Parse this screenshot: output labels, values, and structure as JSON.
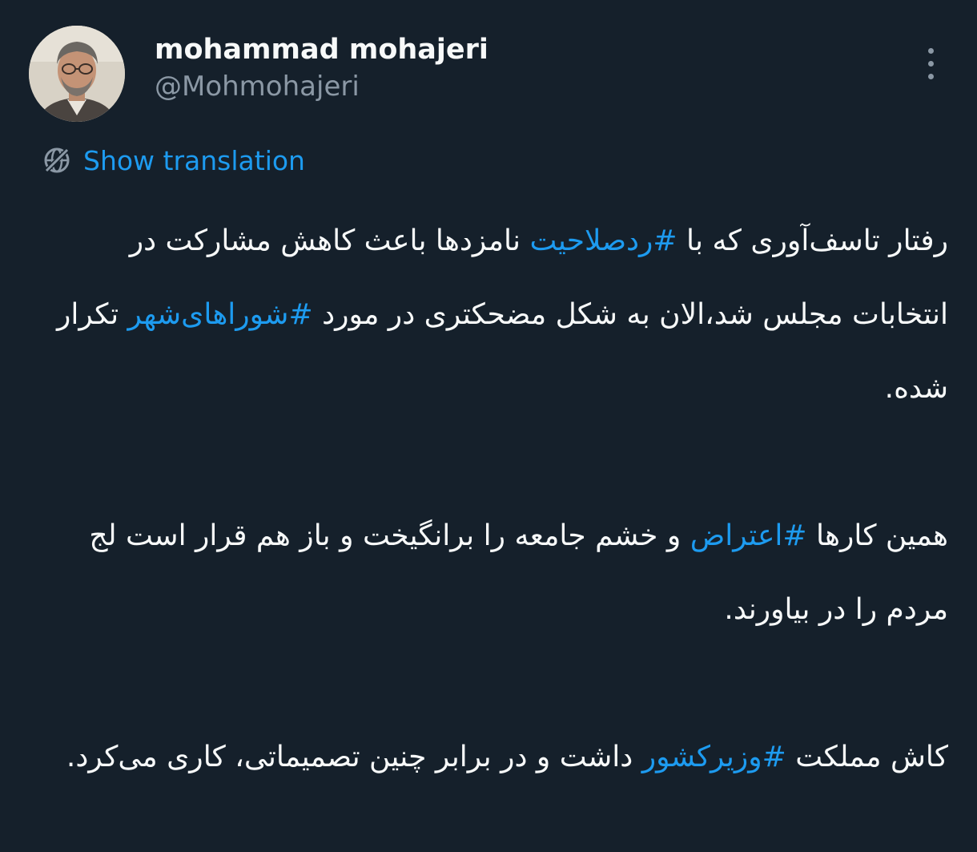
{
  "user": {
    "display_name": "mohammad mohajeri",
    "handle": "@Mohmohajeri",
    "avatar_icon": "user-avatar"
  },
  "actions": {
    "more_icon": "more-vertical-icon"
  },
  "translation": {
    "label": "Show translation",
    "icon": "translate-globe-icon"
  },
  "tweet": {
    "p1": {
      "a": "رفتار تاسف‌آوری که با ",
      "tag1": "#ردصلاحیت",
      "b": " نامزدها باعث کاهش مشارکت در انتخابات مجلس شد،الان به شکل مضحکتری در مورد ",
      "tag2": "#شوراهای‌شهر",
      "c": " تکرار شده."
    },
    "p2": {
      "a": "همین کارها ",
      "tag1": "#اعتراض",
      "b": " و خشم جامعه را برانگیخت و باز هم قرار است لج مردم را در بیاورند."
    },
    "p3": {
      "a": "کاش مملکت ",
      "tag1": "#وزیرکشور",
      "b": " داشت و در برابر چنین تصمیماتی، کاری می‌کرد."
    }
  },
  "colors": {
    "background": "#15202b",
    "text": "#f7f9f9",
    "secondary": "#8b98a5",
    "accent": "#1d9bf0"
  }
}
